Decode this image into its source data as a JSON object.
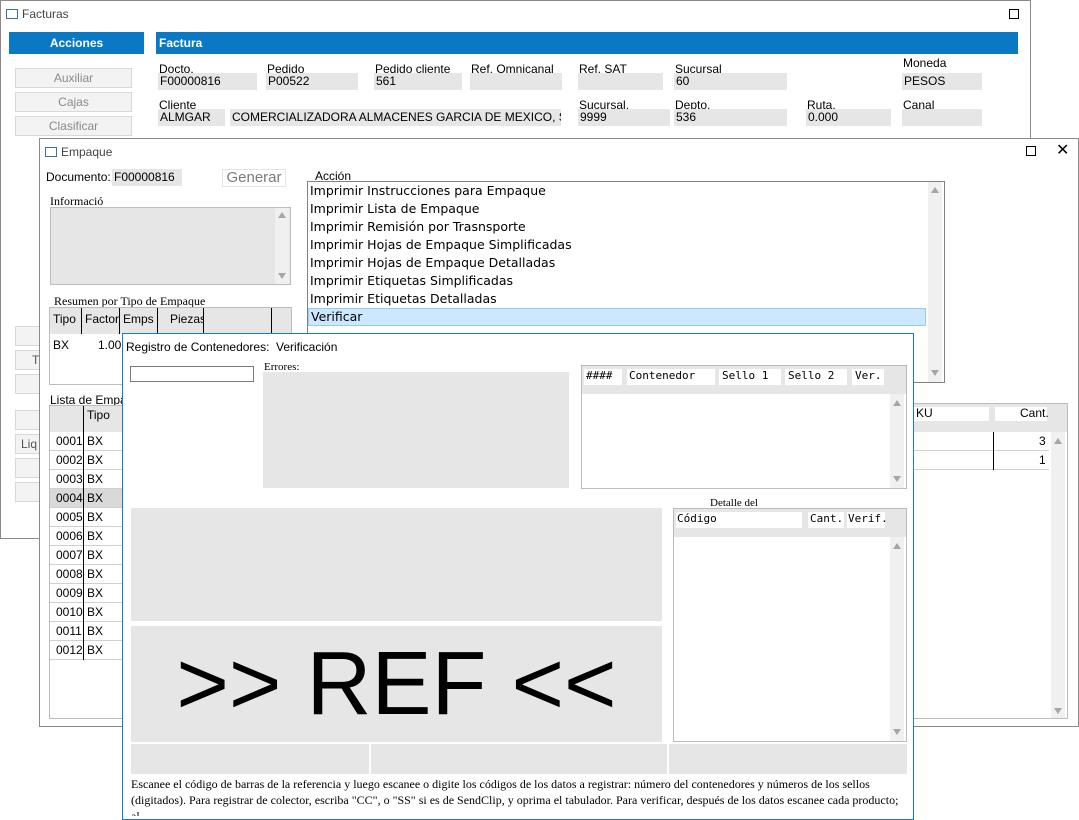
{
  "facturas": {
    "title": "Facturas",
    "acciones_header": "Acciones",
    "factura_header": "Factura",
    "side_buttons": [
      "Auxiliar",
      "Cajas",
      "Clasificar"
    ],
    "partial_labels": [
      "T",
      "Liq"
    ],
    "fields": {
      "docto_label": "Docto.",
      "docto": "F00000816",
      "pedido_label": "Pedido",
      "pedido": "P00522",
      "pedido_cliente_label": "Pedido cliente",
      "pedido_cliente": "561",
      "ref_omnicanal_label": "Ref. Omnicanal",
      "ref_omnicanal": "",
      "ref_sat_label": "Ref. SAT",
      "ref_sat": "",
      "sucursal_label": "Sucursal",
      "sucursal": "60",
      "moneda_label": "Moneda",
      "moneda": "PESOS",
      "cliente_label": "Cliente",
      "cliente_code": "ALMGAR",
      "cliente_name": "COMERCIALIZADORA ALMACENES GARCIA DE MEXICO, SA DI",
      "sucursal2_label": "Sucursal.",
      "sucursal2": "9999",
      "depto_label": "Depto.",
      "depto": "536",
      "ruta_label": "Ruta.",
      "ruta": "0.000",
      "canal_label": "Canal",
      "canal": ""
    }
  },
  "empaque": {
    "title": "Empaque",
    "documento_label": "Documento:",
    "documento": "F00000816",
    "generar": "Generar",
    "informacion_label": "Informació",
    "resumen_label": "Resumen por Tipo de Empaque",
    "resumen_headers": [
      "Tipo",
      "Factor",
      "Emps",
      "Piezas"
    ],
    "resumen_rows": [
      [
        "BX",
        "1.00",
        "",
        ""
      ]
    ],
    "lista_label": "Lista de Empa",
    "lista_header": "Tipo",
    "lista_rows": [
      {
        "num": "0001",
        "tipo": "BX"
      },
      {
        "num": "0002",
        "tipo": "BX"
      },
      {
        "num": "0003",
        "tipo": "BX"
      },
      {
        "num": "0004",
        "tipo": "BX"
      },
      {
        "num": "0005",
        "tipo": "BX"
      },
      {
        "num": "0006",
        "tipo": "BX"
      },
      {
        "num": "0007",
        "tipo": "BX"
      },
      {
        "num": "0008",
        "tipo": "BX"
      },
      {
        "num": "0009",
        "tipo": "BX"
      },
      {
        "num": "0010",
        "tipo": "BX"
      },
      {
        "num": "0011",
        "tipo": "BX"
      },
      {
        "num": "0012",
        "tipo": "BX"
      }
    ],
    "accion_label": "Acción",
    "acciones": [
      "Imprimir Instrucciones para Empaque",
      "Imprimir Lista de Empaque",
      "Imprimir Remisión por Trasnsporte",
      "Imprimir Hojas de Empaque Simplificadas",
      "Imprimir Hojas de Empaque Detalladas",
      "Imprimir Etiquetas Simplificadas",
      "Imprimir Etiquetas Detalladas",
      "Verificar"
    ],
    "sku_header": "KU",
    "cant_header": "Cant.",
    "sku_rows": [
      {
        "cant": "3"
      },
      {
        "cant": "1"
      }
    ]
  },
  "registro": {
    "title": "Registro de Contenedores:",
    "mode": "Verificación",
    "input_value": "",
    "errores_label": "Errores:",
    "contenedores_headers": [
      "####",
      "Contenedor",
      "Sello 1",
      "Sello 2",
      "Ver."
    ],
    "detalle_label": "Detalle del",
    "detalle_headers": [
      "Código",
      "Cant.",
      "Verif."
    ],
    "big_ref": ">> REF <<",
    "help_text": "Escanee el código de barras de la referencia y luego escanee o digite los códigos de los datos a registrar: número del contenedores y números de los sellos (digitados). Para registrar de colector, escriba \"CC\", o \"SS\" si es de SendClip, y oprima el tabulador. Para verificar, después de los datos escanee cada producto; al"
  },
  "colors": {
    "accent": "#0a78c2",
    "selected": "#cce8ff",
    "field": "#e6e6e6"
  }
}
